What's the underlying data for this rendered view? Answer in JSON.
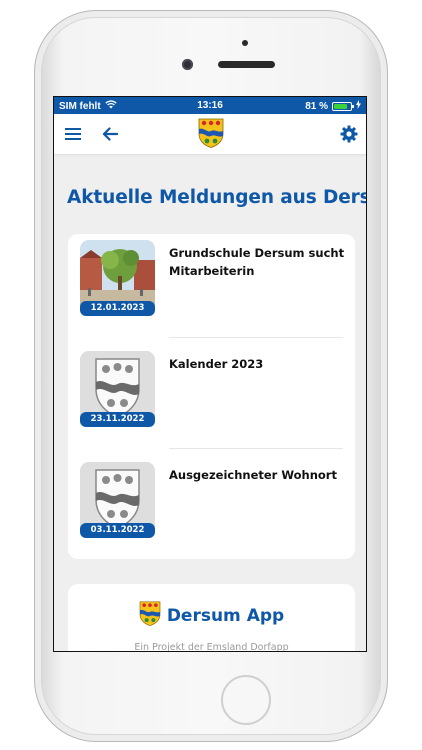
{
  "statusbar": {
    "carrier": "SIM fehlt",
    "time": "13:16",
    "battery": "81 %",
    "battery_level": 0.81
  },
  "appbar": {
    "menu_icon": "hamburger-menu-icon",
    "back_icon": "arrow-left-icon",
    "logo": "dersum-coat-of-arms",
    "settings_icon": "gear-icon"
  },
  "main": {
    "title": "Aktuelle Meldungen aus Dersum",
    "news": [
      {
        "title": "Grundschule Dersum sucht Mitarbeiterin",
        "date": "12.01.2023",
        "thumb": "photo"
      },
      {
        "title": "Kalender 2023",
        "date": "23.11.2022",
        "thumb": "crest"
      },
      {
        "title": "Ausgezeichneter Wohnort",
        "date": "03.11.2022",
        "thumb": "crest"
      }
    ],
    "app_card": {
      "title": "Dersum App",
      "subtitle": "Ein Projekt der Emsland Dorfapp"
    }
  },
  "colors": {
    "accent": "#0e58a7",
    "background": "#efefef",
    "card": "#ffffff"
  }
}
